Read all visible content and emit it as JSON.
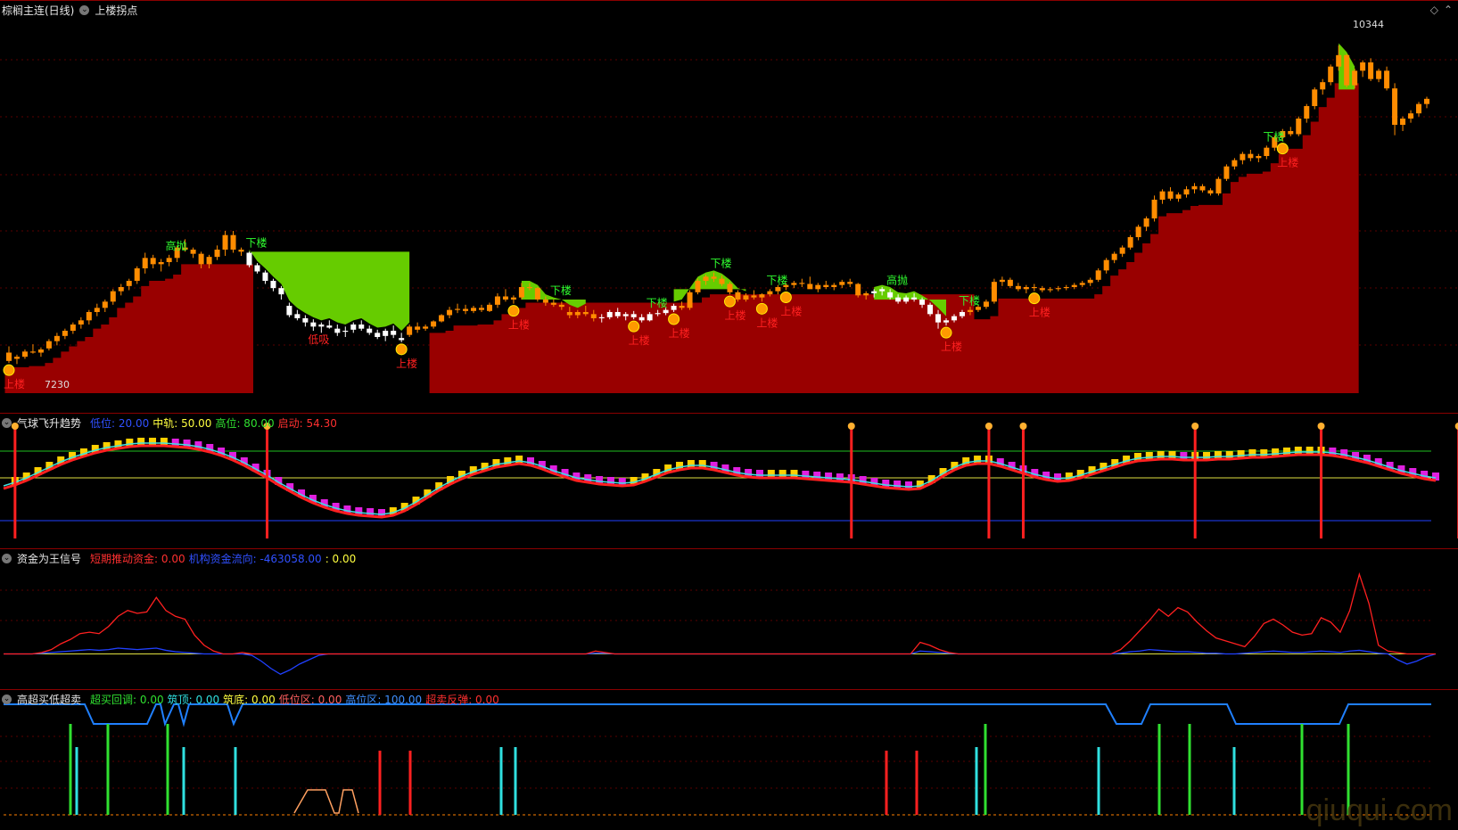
{
  "main": {
    "title": "棕榈主连(日线)",
    "indicator": "上楼拐点",
    "high_label": "10344",
    "low_label": "7230",
    "ylim": [
      7000,
      10600
    ],
    "candles": [
      [
        7390,
        7450,
        7290,
        7310
      ],
      [
        7330,
        7370,
        7280,
        7350
      ],
      [
        7350,
        7420,
        7330,
        7400
      ],
      [
        7400,
        7470,
        7380,
        7390
      ],
      [
        7390,
        7440,
        7350,
        7420
      ],
      [
        7430,
        7520,
        7410,
        7500
      ],
      [
        7500,
        7580,
        7460,
        7550
      ],
      [
        7550,
        7620,
        7520,
        7600
      ],
      [
        7600,
        7680,
        7570,
        7660
      ],
      [
        7660,
        7730,
        7620,
        7700
      ],
      [
        7700,
        7800,
        7660,
        7780
      ],
      [
        7780,
        7860,
        7740,
        7820
      ],
      [
        7820,
        7900,
        7780,
        7880
      ],
      [
        7880,
        8000,
        7850,
        7980
      ],
      [
        7980,
        8050,
        7940,
        8020
      ],
      [
        8030,
        8100,
        7990,
        8080
      ],
      [
        8080,
        8220,
        8050,
        8200
      ],
      [
        8200,
        8350,
        8150,
        8300
      ],
      [
        8300,
        8330,
        8200,
        8240
      ],
      [
        8240,
        8290,
        8170,
        8260
      ],
      [
        8260,
        8330,
        8220,
        8300
      ],
      [
        8300,
        8420,
        8260,
        8400
      ],
      [
        8400,
        8480,
        8360,
        8380
      ],
      [
        8380,
        8400,
        8300,
        8340
      ],
      [
        8340,
        8360,
        8200,
        8240
      ],
      [
        8240,
        8330,
        8200,
        8310
      ],
      [
        8310,
        8420,
        8280,
        8380
      ],
      [
        8380,
        8560,
        8320,
        8520
      ],
      [
        8520,
        8560,
        8350,
        8380
      ],
      [
        8380,
        8400,
        8320,
        8360
      ],
      [
        8350,
        8360,
        8210,
        8230
      ],
      [
        8230,
        8250,
        8150,
        8170
      ],
      [
        8160,
        8180,
        8050,
        8080
      ],
      [
        8080,
        8100,
        7980,
        8010
      ],
      [
        8010,
        8030,
        7900,
        7950
      ],
      [
        7840,
        7870,
        7730,
        7750
      ],
      [
        7760,
        7800,
        7700,
        7720
      ],
      [
        7720,
        7750,
        7640,
        7680
      ],
      [
        7680,
        7710,
        7600,
        7640
      ],
      [
        7640,
        7680,
        7580,
        7660
      ],
      [
        7650,
        7700,
        7620,
        7630
      ],
      [
        7620,
        7660,
        7550,
        7580
      ],
      [
        7590,
        7640,
        7540,
        7600
      ],
      [
        7610,
        7680,
        7580,
        7660
      ],
      [
        7660,
        7700,
        7600,
        7620
      ],
      [
        7620,
        7650,
        7560,
        7580
      ],
      [
        7580,
        7610,
        7520,
        7540
      ],
      [
        7550,
        7620,
        7500,
        7600
      ],
      [
        7600,
        7650,
        7530,
        7560
      ],
      [
        7530,
        7580,
        7490,
        7510
      ],
      [
        7560,
        7660,
        7540,
        7640
      ],
      [
        7640,
        7680,
        7580,
        7610
      ],
      [
        7620,
        7660,
        7600,
        7640
      ],
      [
        7640,
        7700,
        7620,
        7690
      ],
      [
        7690,
        7760,
        7680,
        7750
      ],
      [
        7750,
        7830,
        7720,
        7800
      ],
      [
        7800,
        7860,
        7770,
        7810
      ],
      [
        7810,
        7850,
        7760,
        7790
      ],
      [
        7790,
        7840,
        7770,
        7820
      ],
      [
        7820,
        7850,
        7780,
        7800
      ],
      [
        7790,
        7870,
        7780,
        7850
      ],
      [
        7850,
        7960,
        7820,
        7930
      ],
      [
        7930,
        8000,
        7880,
        7900
      ],
      [
        7900,
        7940,
        7860,
        7920
      ],
      [
        7920,
        8060,
        7900,
        8020
      ],
      [
        8020,
        8060,
        7990,
        8010
      ],
      [
        8010,
        8020,
        7880,
        7900
      ],
      [
        7900,
        7930,
        7840,
        7870
      ],
      [
        7870,
        7900,
        7830,
        7850
      ],
      [
        7850,
        7880,
        7800,
        7830
      ],
      [
        7780,
        7830,
        7720,
        7750
      ],
      [
        7750,
        7800,
        7720,
        7780
      ],
      [
        7780,
        7840,
        7740,
        7760
      ],
      [
        7760,
        7800,
        7690,
        7720
      ],
      [
        7720,
        7760,
        7680,
        7730
      ],
      [
        7730,
        7800,
        7710,
        7780
      ],
      [
        7780,
        7820,
        7720,
        7740
      ],
      [
        7740,
        7780,
        7700,
        7760
      ],
      [
        7760,
        7790,
        7710,
        7730
      ],
      [
        7730,
        7760,
        7680,
        7700
      ],
      [
        7700,
        7780,
        7690,
        7760
      ],
      [
        7760,
        7800,
        7740,
        7770
      ],
      [
        7770,
        7820,
        7750,
        7800
      ],
      [
        7800,
        7860,
        7780,
        7840
      ],
      [
        7840,
        7880,
        7800,
        7820
      ],
      [
        7820,
        7990,
        7800,
        7970
      ],
      [
        7970,
        8100,
        7950,
        8080
      ],
      [
        8080,
        8140,
        8040,
        8120
      ],
      [
        8120,
        8160,
        8070,
        8100
      ],
      [
        8100,
        8130,
        8030,
        8050
      ],
      [
        8050,
        8070,
        7950,
        7970
      ],
      [
        7970,
        7990,
        7880,
        7900
      ],
      [
        7900,
        7960,
        7880,
        7940
      ],
      [
        7940,
        7990,
        7900,
        7920
      ],
      [
        7920,
        7960,
        7880,
        7950
      ],
      [
        7950,
        8000,
        7930,
        7980
      ],
      [
        7980,
        8040,
        7950,
        8020
      ],
      [
        8020,
        8060,
        7990,
        8040
      ],
      [
        8040,
        8080,
        8010,
        8060
      ],
      [
        8060,
        8100,
        8020,
        8050
      ],
      [
        8050,
        8120,
        8030,
        8000
      ],
      [
        8000,
        8060,
        7970,
        8040
      ],
      [
        8040,
        8080,
        8000,
        8020
      ],
      [
        8020,
        8060,
        7990,
        8040
      ],
      [
        8040,
        8090,
        8010,
        8070
      ],
      [
        8070,
        8100,
        8020,
        8050
      ],
      [
        8050,
        8060,
        7920,
        7940
      ],
      [
        7940,
        7980,
        7900,
        7960
      ],
      [
        7960,
        8000,
        7920,
        7980
      ],
      [
        7980,
        8020,
        7940,
        8000
      ],
      [
        7970,
        8000,
        7900,
        7920
      ],
      [
        7920,
        7950,
        7860,
        7880
      ],
      [
        7880,
        7940,
        7860,
        7920
      ],
      [
        7920,
        7960,
        7880,
        7900
      ],
      [
        7900,
        7920,
        7820,
        7850
      ],
      [
        7850,
        7870,
        7740,
        7760
      ],
      [
        7760,
        7800,
        7620,
        7680
      ],
      [
        7680,
        7720,
        7650,
        7700
      ],
      [
        7700,
        7760,
        7680,
        7740
      ],
      [
        7740,
        7800,
        7720,
        7780
      ],
      [
        7780,
        7830,
        7750,
        7800
      ],
      [
        7800,
        7850,
        7780,
        7830
      ],
      [
        7830,
        7900,
        7810,
        7880
      ],
      [
        7880,
        8100,
        7860,
        8070
      ],
      [
        8070,
        8120,
        8030,
        8090
      ],
      [
        8090,
        8110,
        8010,
        8030
      ],
      [
        8030,
        8060,
        7980,
        8000
      ],
      [
        8000,
        8040,
        7960,
        8020
      ],
      [
        8020,
        8050,
        7980,
        8010
      ],
      [
        8010,
        8030,
        7970,
        7990
      ],
      [
        7990,
        8020,
        7970,
        8000
      ],
      [
        8000,
        8030,
        7980,
        8010
      ],
      [
        8010,
        8040,
        7990,
        8020
      ],
      [
        8020,
        8060,
        8000,
        8040
      ],
      [
        8040,
        8080,
        8020,
        8060
      ],
      [
        8060,
        8110,
        8030,
        8090
      ],
      [
        8090,
        8200,
        8070,
        8180
      ],
      [
        8180,
        8300,
        8150,
        8280
      ],
      [
        8280,
        8360,
        8250,
        8340
      ],
      [
        8340,
        8420,
        8310,
        8400
      ],
      [
        8400,
        8520,
        8380,
        8500
      ],
      [
        8500,
        8620,
        8470,
        8600
      ],
      [
        8600,
        8700,
        8560,
        8680
      ],
      [
        8680,
        8900,
        8650,
        8860
      ],
      [
        8860,
        8960,
        8820,
        8940
      ],
      [
        8940,
        8980,
        8850,
        8870
      ],
      [
        8870,
        8930,
        8840,
        8910
      ],
      [
        8910,
        8990,
        8880,
        8960
      ],
      [
        8960,
        9020,
        8920,
        8990
      ],
      [
        8990,
        9010,
        8930,
        8950
      ],
      [
        8950,
        8970,
        8900,
        8920
      ],
      [
        8920,
        9080,
        8900,
        9060
      ],
      [
        9060,
        9200,
        9040,
        9180
      ],
      [
        9180,
        9260,
        9150,
        9240
      ],
      [
        9240,
        9320,
        9200,
        9300
      ],
      [
        9300,
        9340,
        9230,
        9260
      ],
      [
        9260,
        9300,
        9220,
        9280
      ],
      [
        9280,
        9380,
        9250,
        9360
      ],
      [
        9360,
        9480,
        9330,
        9460
      ],
      [
        9460,
        9540,
        9420,
        9520
      ],
      [
        9520,
        9560,
        9470,
        9490
      ],
      [
        9490,
        9660,
        9470,
        9640
      ],
      [
        9640,
        9780,
        9600,
        9760
      ],
      [
        9760,
        9940,
        9730,
        9920
      ],
      [
        9920,
        10020,
        9870,
        9990
      ],
      [
        9990,
        10160,
        9960,
        10140
      ],
      [
        10140,
        10344,
        10100,
        10250
      ],
      [
        10250,
        10260,
        9940,
        9960
      ],
      [
        9960,
        10120,
        9930,
        10100
      ],
      [
        10100,
        10200,
        10040,
        10180
      ],
      [
        10180,
        10220,
        10000,
        10020
      ],
      [
        10020,
        10120,
        9990,
        10100
      ],
      [
        10100,
        10140,
        9910,
        9930
      ],
      [
        9930,
        9980,
        9480,
        9580
      ],
      [
        9580,
        9660,
        9520,
        9640
      ],
      [
        9640,
        9720,
        9600,
        9690
      ],
      [
        9690,
        9800,
        9660,
        9780
      ],
      [
        9780,
        9850,
        9740,
        9830
      ]
    ],
    "signals": {
      "up": "上楼",
      "down": "下楼",
      "tag_high": "高抛",
      "tag_low": "低吸"
    }
  },
  "p2": {
    "title": "气球飞升趋势",
    "labels": [
      {
        "text": "低位: 20.00",
        "color": "#3050ff"
      },
      {
        "text": "中轨: 50.00",
        "color": "#ffff40"
      },
      {
        "text": "高位: 80.00",
        "color": "#30e030"
      },
      {
        "text": "启动: 54.30",
        "color": "#ff3030"
      }
    ],
    "ylim": [
      0,
      100
    ],
    "low": 20,
    "mid": 50,
    "high": 80,
    "line": [
      42,
      46,
      51,
      57,
      63,
      69,
      74,
      78,
      82,
      85,
      87,
      89,
      90,
      90,
      90,
      89,
      88,
      86,
      83,
      79,
      74,
      68,
      61,
      54,
      46,
      39,
      32,
      26,
      21,
      17,
      14,
      12,
      11,
      10,
      12,
      17,
      24,
      32,
      40,
      47,
      53,
      58,
      62,
      66,
      68,
      70,
      68,
      64,
      59,
      55,
      51,
      49,
      47,
      46,
      45,
      46,
      50,
      55,
      60,
      63,
      65,
      65,
      63,
      60,
      57,
      55,
      54,
      54,
      54,
      54,
      53,
      52,
      51,
      50,
      49,
      47,
      45,
      43,
      42,
      41,
      42,
      48,
      56,
      63,
      68,
      70,
      70,
      67,
      63,
      59,
      55,
      52,
      50,
      51,
      54,
      58,
      62,
      66,
      70,
      73,
      74,
      75,
      75,
      74,
      74,
      74,
      75,
      75,
      76,
      77,
      77,
      78,
      79,
      80,
      80,
      80,
      79,
      77,
      74,
      71,
      67,
      63,
      59,
      56,
      53,
      51
    ]
  },
  "p3": {
    "title": "资金为王信号",
    "labels": [
      {
        "text": "短期推动资金: 0.00",
        "color": "#ff3030"
      },
      {
        "text": "机构资金流向: -463058.00",
        "color": "#3050ff"
      },
      {
        "text": ": 0.00",
        "color": "#ffff40"
      }
    ],
    "red": [
      0,
      0,
      0,
      0,
      2,
      6,
      14,
      20,
      28,
      30,
      28,
      38,
      52,
      60,
      56,
      58,
      78,
      60,
      52,
      48,
      26,
      12,
      4,
      0,
      0,
      2,
      0,
      0,
      0,
      0,
      0,
      0,
      0,
      0,
      0,
      0,
      0,
      0,
      0,
      0,
      0,
      0,
      0,
      0,
      0,
      0,
      0,
      0,
      0,
      0,
      0,
      0,
      0,
      0,
      0,
      0,
      0,
      0,
      0,
      0,
      0,
      0,
      4,
      2,
      0,
      0,
      0,
      0,
      0,
      0,
      0,
      0,
      0,
      0,
      0,
      0,
      0,
      0,
      0,
      0,
      0,
      0,
      0,
      0,
      0,
      0,
      0,
      0,
      0,
      0,
      0,
      0,
      0,
      0,
      0,
      0,
      16,
      12,
      6,
      2,
      0,
      0,
      0,
      0,
      0,
      0,
      0,
      0,
      0,
      0,
      0,
      0,
      0,
      0,
      0,
      0,
      0,
      6,
      18,
      32,
      46,
      62,
      52,
      64,
      58,
      44,
      32,
      22,
      18,
      14,
      10,
      24,
      42,
      48,
      40,
      30,
      26,
      28,
      50,
      44,
      30,
      60,
      110,
      70,
      12,
      4,
      2,
      0,
      0,
      0,
      0
    ],
    "blue": [
      0,
      0,
      0,
      0,
      1,
      2,
      3,
      4,
      5,
      6,
      5,
      6,
      8,
      7,
      6,
      7,
      8,
      5,
      3,
      2,
      1,
      0,
      0,
      0,
      0,
      0,
      -2,
      -10,
      -20,
      -28,
      -22,
      -14,
      -8,
      -2,
      0,
      0,
      0,
      0,
      0,
      0,
      0,
      0,
      0,
      0,
      0,
      0,
      0,
      0,
      0,
      0,
      0,
      0,
      0,
      0,
      0,
      0,
      0,
      0,
      0,
      0,
      0,
      0,
      1,
      1,
      0,
      0,
      0,
      0,
      0,
      0,
      0,
      0,
      0,
      0,
      0,
      0,
      0,
      0,
      0,
      0,
      0,
      0,
      0,
      0,
      0,
      0,
      0,
      0,
      0,
      0,
      0,
      0,
      0,
      0,
      0,
      0,
      4,
      3,
      2,
      1,
      0,
      0,
      0,
      0,
      0,
      0,
      0,
      0,
      0,
      0,
      0,
      0,
      0,
      0,
      0,
      0,
      0,
      1,
      3,
      4,
      6,
      5,
      4,
      3,
      3,
      2,
      1,
      1,
      0,
      0,
      1,
      2,
      3,
      4,
      3,
      2,
      2,
      3,
      4,
      3,
      2,
      4,
      5,
      3,
      1,
      0,
      -8,
      -14,
      -10,
      -4,
      0
    ],
    "ylim": [
      -40,
      120
    ]
  },
  "p4": {
    "title": "高超买低超卖",
    "labels": [
      {
        "text": "超买回调: 0.00",
        "color": "#30e030"
      },
      {
        "text": "筑顶: 0.00",
        "color": "#30e0e0"
      },
      {
        "text": "筑底: 0.00",
        "color": "#ffff40"
      },
      {
        "text": "低位区: 0.00",
        "color": "#ff6060"
      },
      {
        "text": "高位区: 100.00",
        "color": "#4090ff"
      },
      {
        "text": "超卖反弹: 0.00",
        "color": "#ff3030"
      }
    ]
  },
  "watermark": "qiuqui.com"
}
